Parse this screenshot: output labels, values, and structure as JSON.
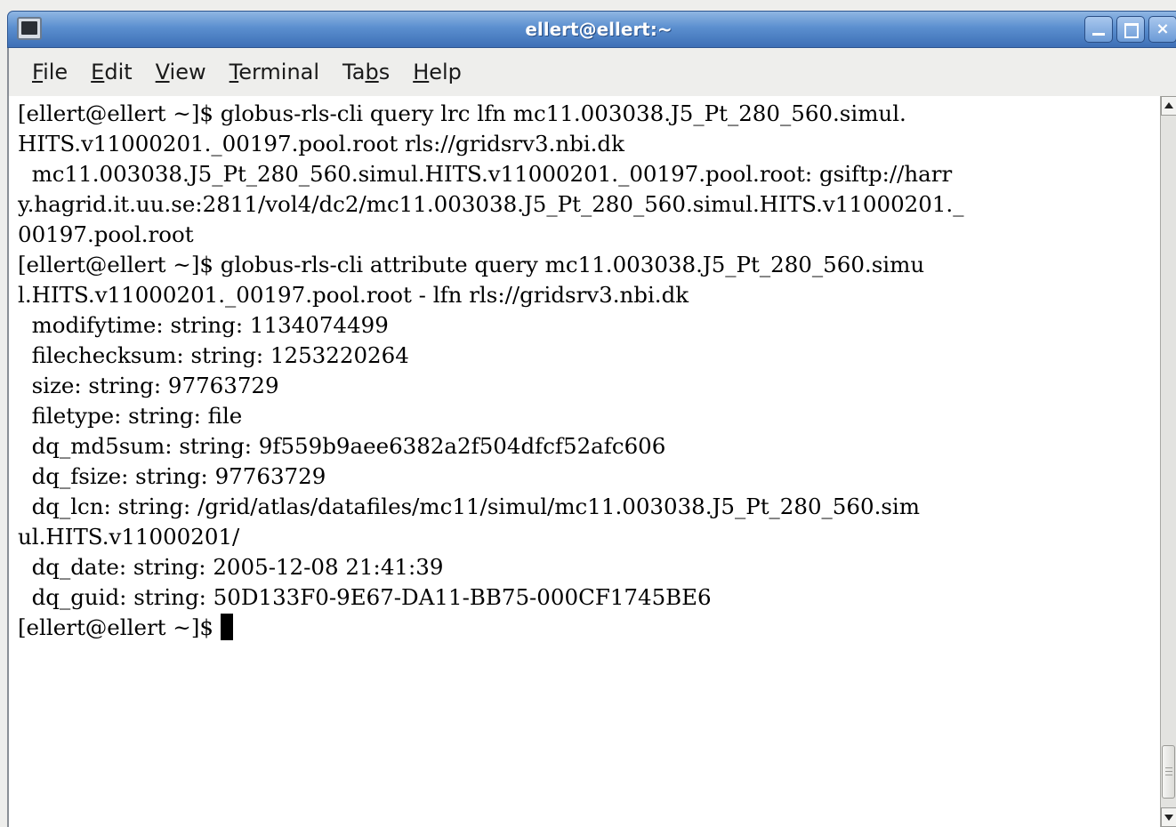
{
  "window": {
    "title": "ellert@ellert:~",
    "app_icon": "terminal-icon",
    "buttons": [
      "minimize-icon",
      "maximize-icon",
      "close-icon"
    ],
    "close_glyph": "×"
  },
  "menu": {
    "items": [
      {
        "label": "File",
        "mnemonic": "F"
      },
      {
        "label": "Edit",
        "mnemonic": "E"
      },
      {
        "label": "View",
        "mnemonic": "V"
      },
      {
        "label": "Terminal",
        "mnemonic": "T"
      },
      {
        "label": "Tabs",
        "mnemonic": "b"
      },
      {
        "label": "Help",
        "mnemonic": "H"
      }
    ]
  },
  "terminal": {
    "lines": [
      "[ellert@ellert ~]$ globus-rls-cli query lrc lfn mc11.003038.J5_Pt_280_560.simul.",
      "HITS.v11000201._00197.pool.root rls://gridsrv3.nbi.dk",
      "  mc11.003038.J5_Pt_280_560.simul.HITS.v11000201._00197.pool.root: gsiftp://harr",
      "y.hagrid.it.uu.se:2811/vol4/dc2/mc11.003038.J5_Pt_280_560.simul.HITS.v11000201._",
      "00197.pool.root",
      "[ellert@ellert ~]$ globus-rls-cli attribute query mc11.003038.J5_Pt_280_560.simu",
      "l.HITS.v11000201._00197.pool.root - lfn rls://gridsrv3.nbi.dk",
      "  modifytime: string: 1134074499",
      "  filechecksum: string: 1253220264",
      "  size: string: 97763729",
      "  filetype: string: file",
      "  dq_md5sum: string: 9f559b9aee6382a2f504dfcf52afc606",
      "  dq_fsize: string: 97763729",
      "  dq_lcn: string: /grid/atlas/datafiles/mc11/simul/mc11.003038.J5_Pt_280_560.sim",
      "ul.HITS.v11000201/",
      "  dq_date: string: 2005-12-08 21:41:39",
      "  dq_guid: string: 50D133F0-9E67-DA11-BB75-000CF1745BE6"
    ],
    "prompt": "[ellert@ellert ~]$ "
  },
  "colors": {
    "titlebar": "#5b8fcf",
    "terminal_bg": "#ffffff",
    "terminal_fg": "#000000",
    "menubar_bg": "#eeeeec"
  }
}
